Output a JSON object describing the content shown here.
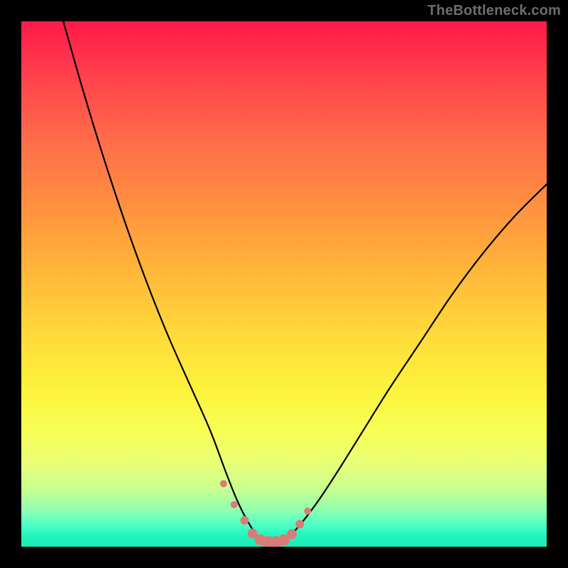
{
  "watermark": "TheBottleneck.com",
  "chart_data": {
    "type": "line",
    "title": "",
    "xlabel": "",
    "ylabel": "",
    "xlim": [
      0,
      100
    ],
    "ylim": [
      0,
      100
    ],
    "grid": false,
    "series": [
      {
        "name": "bottleneck-curve",
        "x": [
          8,
          12,
          16,
          20,
          24,
          28,
          32,
          36,
          39,
          41,
          43,
          45,
          47,
          49,
          52,
          56,
          60,
          65,
          70,
          76,
          82,
          88,
          94,
          100
        ],
        "y": [
          100,
          86,
          73,
          61,
          50,
          40,
          31,
          22,
          14,
          9,
          5,
          2,
          1,
          1,
          3,
          8,
          14,
          22,
          30,
          39,
          48,
          56,
          63,
          69
        ]
      }
    ],
    "markers": {
      "name": "highlight-points",
      "color": "#d97b78",
      "x": [
        38.5,
        40.5,
        42.5,
        44.0,
        45.5,
        47.0,
        48.5,
        50.0,
        51.5,
        53.0,
        54.5
      ],
      "y": [
        12.0,
        8.0,
        5.0,
        2.5,
        1.3,
        0.8,
        0.8,
        1.3,
        2.4,
        4.3,
        6.8
      ],
      "r": [
        5,
        5,
        6,
        7,
        8,
        9,
        9,
        8,
        7,
        6,
        5
      ]
    }
  }
}
